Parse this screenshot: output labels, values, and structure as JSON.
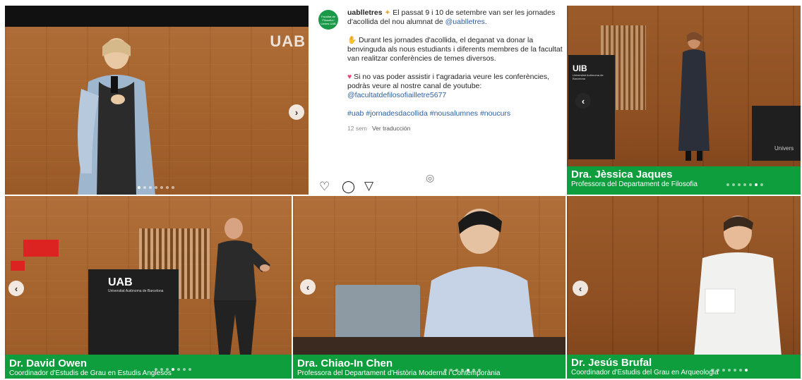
{
  "colors": {
    "caption_green": "#0e9e3e",
    "mention_blue": "#2f5f9f",
    "wood": "#a7652f"
  },
  "panels": {
    "top_left": {
      "wall_text": "UAB",
      "nav_icon": "chevron-right-icon"
    },
    "top_right": {
      "name": "Dra. Jèssica Jaques",
      "role": "Professora del Departament de Filosofia",
      "podium_text": "UIB",
      "podium_sub": "Universitat Autònoma de Barcelona",
      "podium2_text": "Univers",
      "nav_icon": "chevron-left-icon"
    },
    "bottom_left": {
      "name": "Dr. David Owen",
      "role": "Coordinador d'Estudis de Grau en Estudis Anglesos",
      "podium_text": "UAB",
      "podium_sub": "Universitat Autònoma de Barcelona",
      "nav_icon": "chevron-left-icon"
    },
    "bottom_mid": {
      "name": "Dra. Chiao-In Chen",
      "role": "Professora del Departament d'Història Moderna i Contemporània",
      "nav_icon": "chevron-left-icon"
    },
    "bottom_right": {
      "name": "Dr. Jesús Brufal",
      "role": "Coordinador d'Estudis del Grau en Arqueologia",
      "nav_icon": "chevron-left-icon"
    }
  },
  "post": {
    "avatar_text": "Facultat de Filosofia i Lletres UAB",
    "username": "uablletres",
    "line1": "El passat 9 i 10 de setembre van ser les jornades d'acollida del nou alumnat de",
    "mention1": "@uablletres",
    "line1_end": ".",
    "para2": "Durant les jornades d'acollida, el deganat va donar la benvinguda als nous estudiants i diferents membres de la facultat van realitzar conferències de temes diversos.",
    "para3": "Si no vas poder assistir i t'agradaria veure les conferències, podràs veure al nostre canal de youtube:",
    "mention2": "@facultatdefilosofiailletre5677",
    "hashtags": "#uab #jornadesdacollida #nousalumnes #noucurs",
    "age": "12 sem",
    "translate": "Ver traducción",
    "icons": [
      "heart-icon",
      "comment-icon",
      "share-icon"
    ]
  }
}
